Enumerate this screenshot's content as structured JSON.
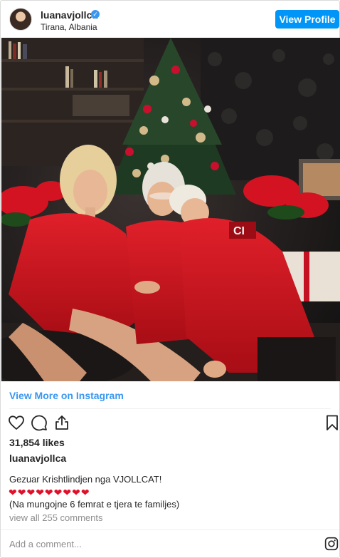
{
  "header": {
    "username": "luanavjollca",
    "verified_mark": "✓",
    "location": "Tirana, Albania",
    "view_profile_label": "View Profile"
  },
  "post": {
    "view_more_label": "View More on Instagram",
    "likes": "31,854 likes",
    "caption_user": "luanavjollca",
    "caption_line1": "Gezuar Krishtlindjen nga VJOLLCAT!",
    "hearts": "❤❤❤❤❤❤❤❤❤",
    "caption_line2": "(Na mungojne 6 femrat e tjera te familjes)",
    "view_comments": "view all 255 comments",
    "add_comment_placeholder": "Add a comment..."
  },
  "icons": {
    "like": "heart-outline-icon",
    "comment": "comment-bubble-icon",
    "share": "share-icon",
    "save": "bookmark-icon",
    "brand": "instagram-icon"
  },
  "colors": {
    "link": "#3897f0",
    "button": "#0095f6",
    "hearts": "#e0102a",
    "muted": "#8e8e8e"
  }
}
